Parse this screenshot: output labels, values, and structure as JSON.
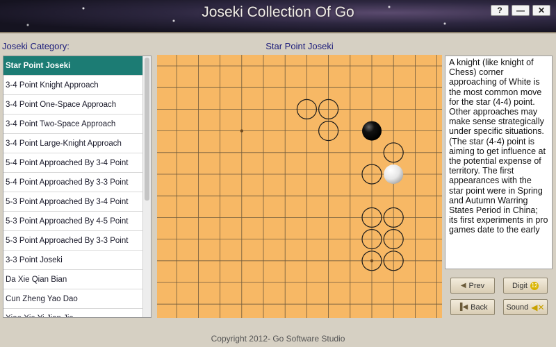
{
  "window": {
    "title": "Joseki Collection Of Go",
    "help_label": "?",
    "minimize_label": "—",
    "close_label": "✕"
  },
  "sidebar": {
    "label": "Joseki Category:",
    "items": [
      {
        "label": "Star Point Joseki",
        "selected": true
      },
      {
        "label": "3-4 Point Knight Approach"
      },
      {
        "label": "3-4 Point One-Space Approach"
      },
      {
        "label": "3-4 Point Two-Space Approach"
      },
      {
        "label": "3-4 Point Large-Knight Approach"
      },
      {
        "label": "5-4 Point Approached By 3-4 Point"
      },
      {
        "label": "5-4 Point Approached By 3-3 Point"
      },
      {
        "label": "5-3 Point Approached By 3-4 Point"
      },
      {
        "label": "5-3 Point Approached By 4-5 Point"
      },
      {
        "label": "5-3 Point Approached By 3-3 Point"
      },
      {
        "label": "3-3 Point Joseki"
      },
      {
        "label": "Da Xie Qian Bian"
      },
      {
        "label": "Cun Zheng Yao Dao"
      },
      {
        "label": "Xiao Xie Yi Jian Jia"
      }
    ]
  },
  "board": {
    "title": "Star Point Joseki",
    "columns": 13,
    "rows": 12,
    "star_points": [
      [
        4,
        3
      ],
      [
        10,
        9
      ]
    ],
    "stones": [
      {
        "col": 10,
        "row": 3,
        "color": "black"
      },
      {
        "col": 11,
        "row": 5,
        "color": "white"
      }
    ],
    "candidate_moves": [
      [
        7,
        2
      ],
      [
        8,
        2
      ],
      [
        8,
        3
      ],
      [
        11,
        4
      ],
      [
        10,
        5
      ],
      [
        10,
        7
      ],
      [
        11,
        7
      ],
      [
        10,
        8
      ],
      [
        11,
        8
      ],
      [
        10,
        9
      ],
      [
        11,
        9
      ]
    ]
  },
  "description": {
    "text": "A knight (like knight of Chess) corner approaching  of White is the most common move for the star (4-4) point.   Other approaches may make sense strategically under specific situations. (The star (4-4) point  is aiming to get influence at the potential expense of territory. The first appearances with the star point were in Spring and Autumn Warring States Period in China; its first experiments in pro games date to the early"
  },
  "controls": {
    "prev_label": "Prev",
    "digit_label": "Digit",
    "back_label": "Back",
    "sound_label": "Sound"
  },
  "footer": {
    "text": "Copyright 2012- Go Software Studio"
  }
}
